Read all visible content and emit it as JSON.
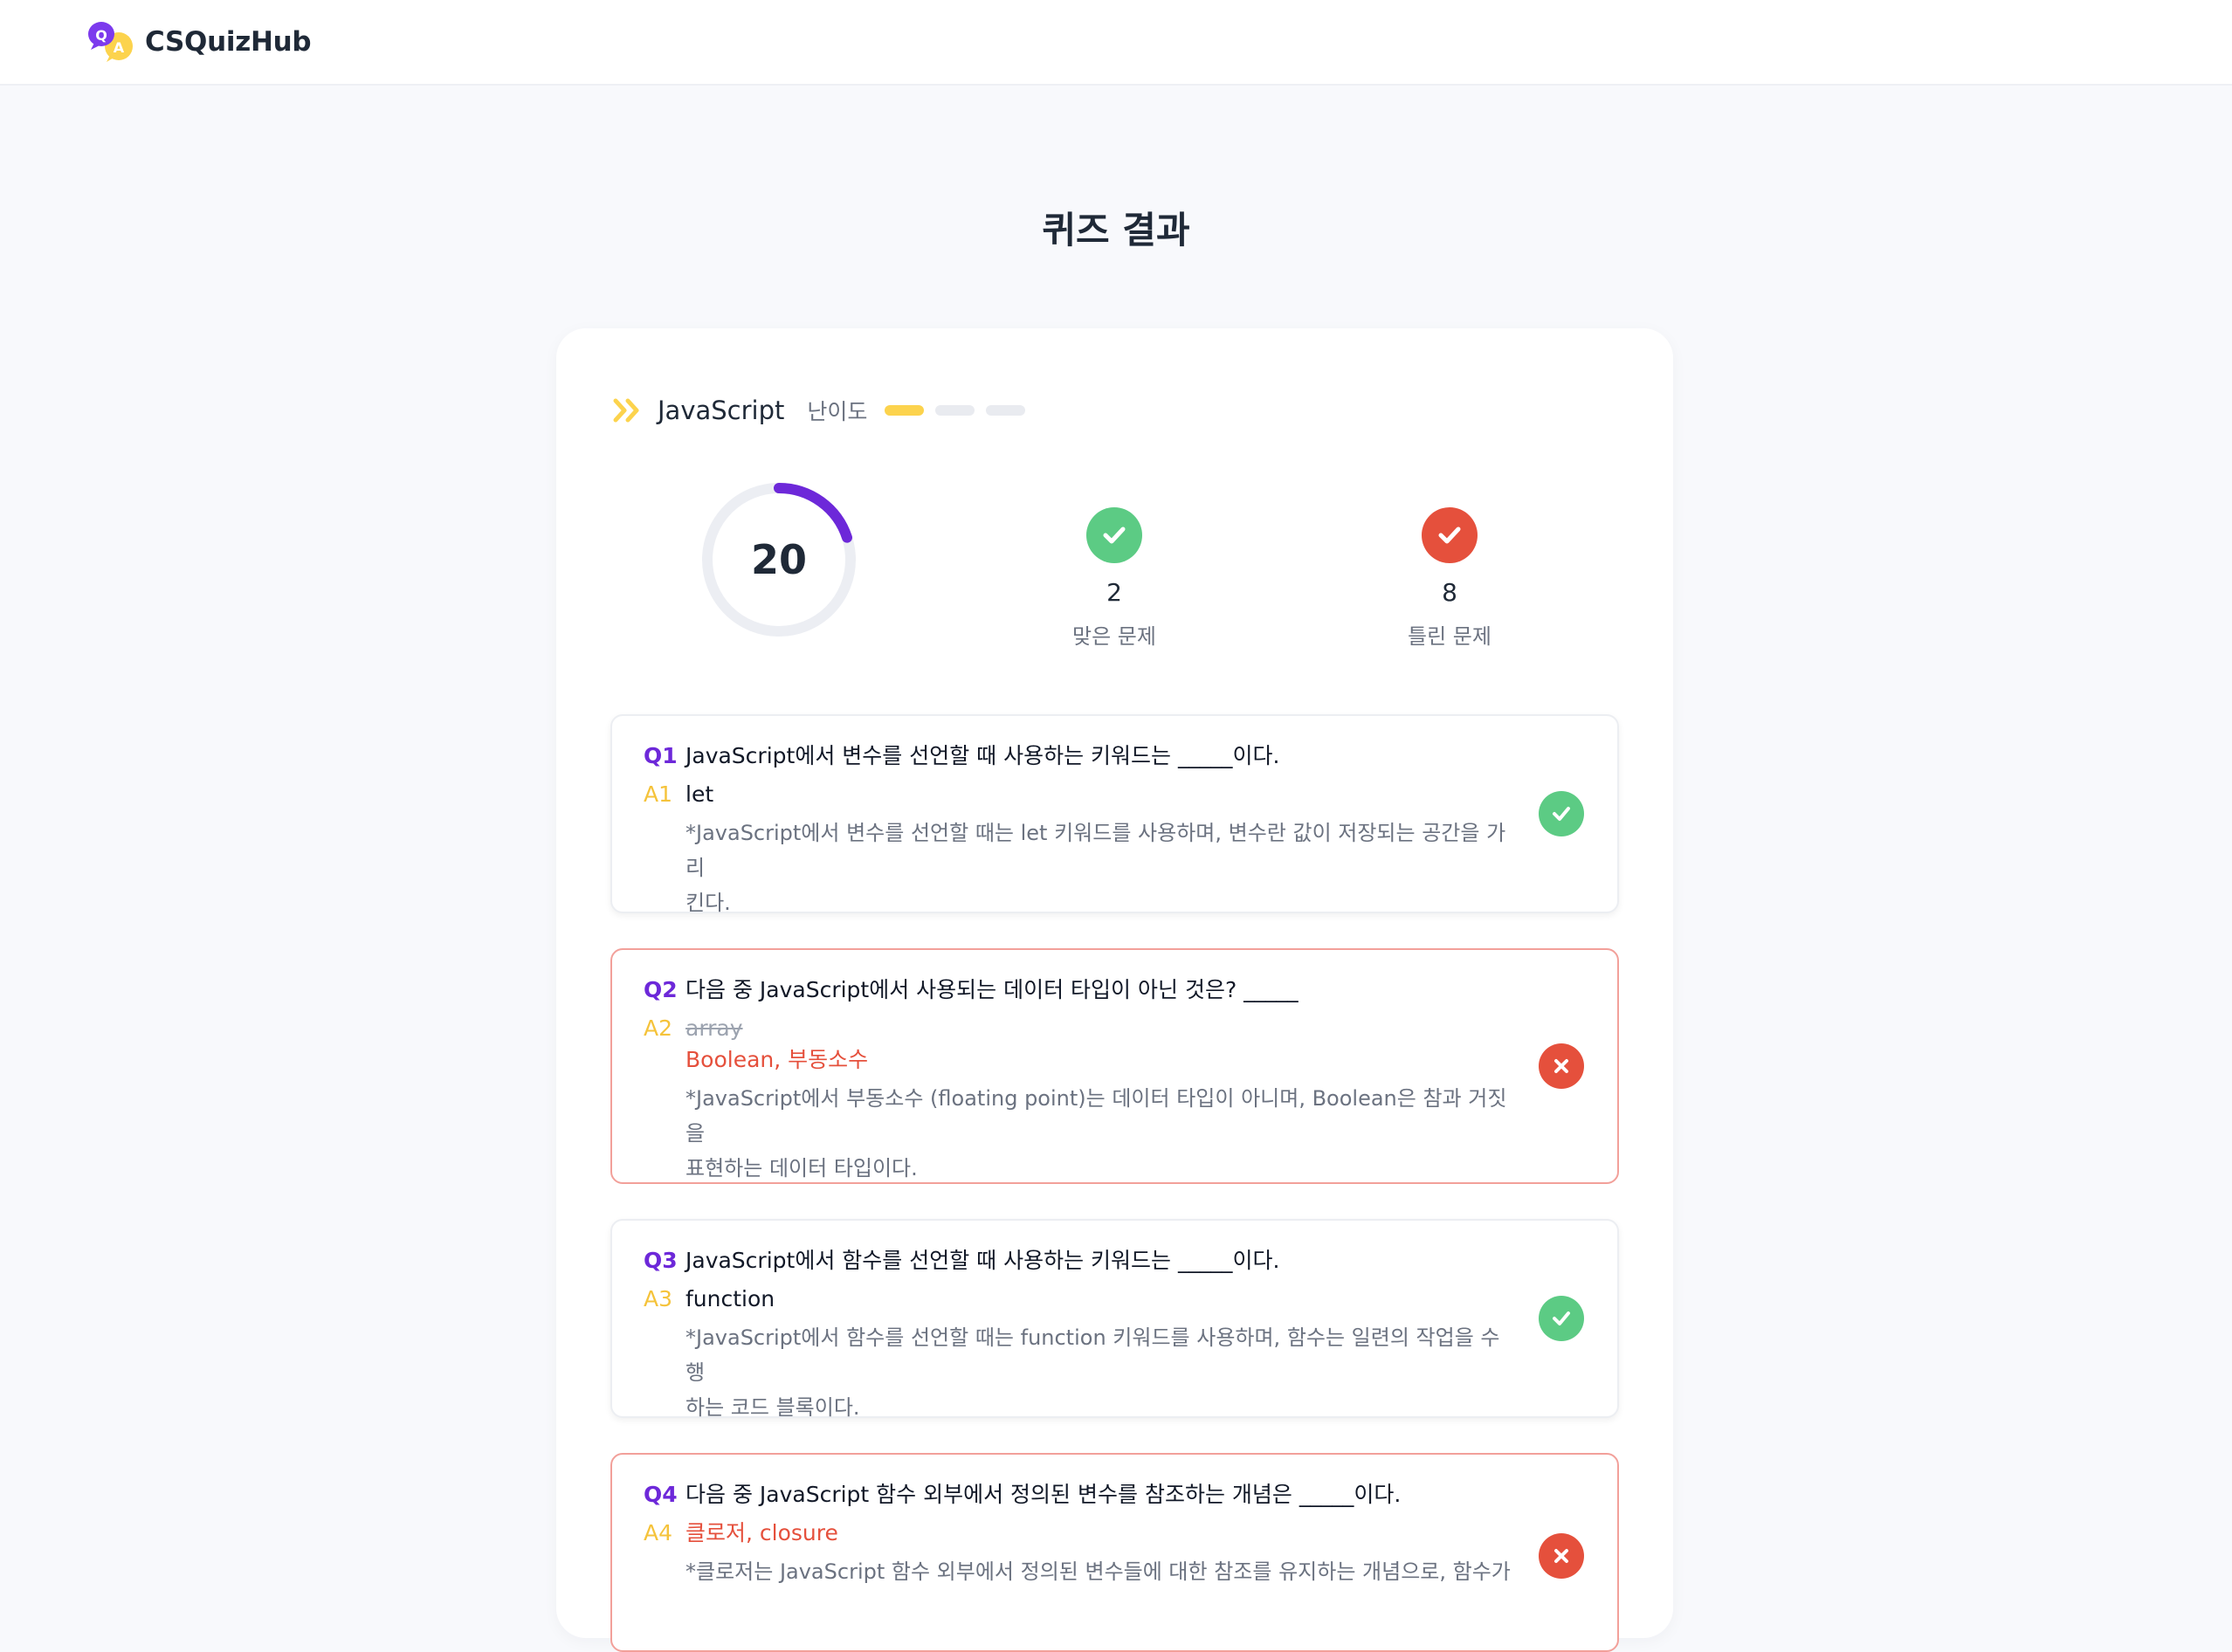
{
  "header": {
    "logo_text": "CSQuizHub"
  },
  "page": {
    "title": "퀴즈 결과"
  },
  "summary": {
    "language": "JavaScript",
    "difficulty_label": "난이도",
    "difficulty_level": 1,
    "difficulty_max": 3,
    "score": "20",
    "score_fraction": 0.2,
    "correct_count": "2",
    "correct_label": "맞은 문제",
    "wrong_count": "8",
    "wrong_label": "틀린 문제"
  },
  "colors": {
    "accent": "#6d28d9",
    "correct": "#5ccb84",
    "wrong": "#e5503c",
    "difficulty_on": "#fcd34d"
  },
  "questions": [
    {
      "q_tag": "Q1",
      "question": "JavaScript에서 변수를 선언할 때 사용하는 키워드는 _____이다.",
      "a_tag": "A1",
      "answer": "let",
      "explanation_l1": "*JavaScript에서 변수를 선언할 때는 let 키워드를 사용하며, 변수란 값이 저장되는 공간을 가리",
      "explanation_l2": "킨다.",
      "result": "correct"
    },
    {
      "q_tag": "Q2",
      "question": "다음 중 JavaScript에서 사용되는 데이터 타입이 아닌 것은? _____",
      "a_tag": "A2",
      "user_answer": "array",
      "answer": "Boolean, 부동소수",
      "explanation_l1": "*JavaScript에서 부동소수 (floating point)는 데이터 타입이 아니며, Boolean은 참과 거짓을",
      "explanation_l2": "표현하는 데이터 타입이다.",
      "result": "wrong"
    },
    {
      "q_tag": "Q3",
      "question": "JavaScript에서 함수를 선언할 때 사용하는 키워드는 _____이다.",
      "a_tag": "A3",
      "answer": "function",
      "explanation_l1": "*JavaScript에서 함수를 선언할 때는 function 키워드를 사용하며, 함수는 일련의 작업을 수행",
      "explanation_l2": "하는 코드 블록이다.",
      "result": "correct"
    },
    {
      "q_tag": "Q4",
      "question": "다음 중 JavaScript 함수 외부에서 정의된 변수를 참조하는 개념은 _____이다.",
      "a_tag": "A4",
      "answer": "클로저, closure",
      "explanation_l1": "*클로저는 JavaScript 함수 외부에서 정의된 변수들에 대한 참조를 유지하는 개념으로, 함수가",
      "result": "wrong"
    }
  ]
}
